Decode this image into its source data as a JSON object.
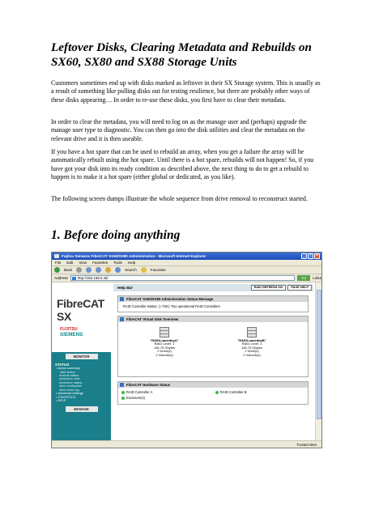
{
  "document": {
    "title": "Leftover Disks, Clearing Metadata and Rebuilds on SX60, SX80 and SX88 Storage Units",
    "paragraphs": [
      "Customers sometimes end up with disks marked as leftover in their SX Storage system. This is usually as a result of something like pulling disks out for testing resilience, but there are probably other ways of these disks appearing… In order to re-use these disks, you first have to clear their metadata.",
      "In order to clear the metadata, you will need to log on as the manage user and (perhaps) upgrade the manage user type to diagnostic. You can then go into the disk utilities and clear the metadata on the relevant drive and it is then useable.",
      "If you have a hot spare that can be used to rebuild an array, when you get a failure the array will be automatically rebuilt using the hot spare. Until there is a hot spare, rebuilds will not happen! So, if you have got your disk into its ready condition as described above, the next thing to do to get a rebuild to happen is to make it a hot spare (either global or dedicated, as you like).",
      "The following screen dumps illustrate the whole sequence from drive removal to reconstruct started."
    ],
    "section_heading": "1. Before doing anything"
  },
  "browser": {
    "window_title": "Fujitsu Siemens FibreCAT SX60/SX80 Administration - Microsoft Internet Explorer",
    "menu": [
      "File",
      "Edit",
      "View",
      "Favorites",
      "Tools",
      "Help"
    ],
    "toolbar": {
      "back": "Back",
      "search": "Search",
      "favorites": "Favorites"
    },
    "address_label": "Address",
    "address": "http://192.168.0.46/",
    "go": "Go",
    "links": "Links",
    "status_zone": "Trusted sites"
  },
  "app": {
    "brand": "FibreCAT SX",
    "logo_line1": "FUJITSU",
    "logo_line2": "SIEMENS",
    "nav": {
      "monitor": "MONITOR",
      "status_head": "STATUS",
      "status_items": [
        "• status summary"
      ],
      "status_subitems": [
        "·disk status",
        "module status",
        "enclosure view",
        "enclosure status",
        "drive verification",
        "view event log"
      ],
      "extra_items": [
        "• advanced settings",
        "• STATISTICS",
        "• HELP"
      ],
      "manage": "MANAGE"
    },
    "help_bar": {
      "label": "Help Bar",
      "raid_refresh": "RAID REFRESH ON",
      "page_help": "PAGE HELP"
    },
    "status_panel": {
      "title": "FibreCAT SX60/SX80 Administration Status Message",
      "message": "RAID Controller Status: (✓/OK): Two operational RAID Controllers"
    },
    "vdisk_panel": {
      "title": "FibreCAT Virtual Disk Overview",
      "vdisks": [
        {
          "name": "\"RAIDLoanedbyA\"",
          "level": "RAID Level: 1",
          "size": "146.79 Gbytes",
          "drives": "2 Drive(s)",
          "volumes": "2 Volume(s)"
        },
        {
          "name": "\"RAIDLoanedbyB\"",
          "level": "RAID Level: 1",
          "size": "146.79 Gbytes",
          "drives": "2 Drive(s)",
          "volumes": "2 Volume(s)"
        }
      ]
    },
    "hw_panel": {
      "title": "FibreCAT Hardware Status",
      "items": [
        "RAID Controller A",
        "RAID Controller B",
        "Enclosure(s)"
      ]
    }
  },
  "colors": {
    "nav_bg": "#1a7f8a",
    "fujitsu_red": "#cc1f1f",
    "siemens_teal": "#0c8a8a",
    "titlebar": "#1d4cb8"
  }
}
